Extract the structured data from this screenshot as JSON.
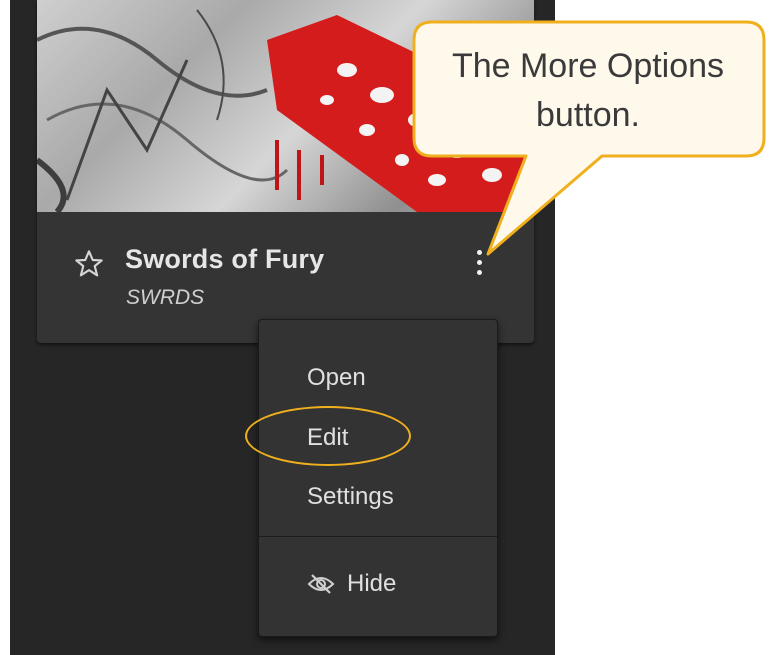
{
  "card": {
    "title": "Swords of Fury",
    "subtitle": "SWRDS",
    "favorite_icon": "star-outline-icon",
    "more_options_icon": "vertical-ellipsis-icon"
  },
  "menu": {
    "open_label": "Open",
    "edit_label": "Edit",
    "settings_label": "Settings",
    "hide_label": "Hide",
    "hide_icon": "eye-slash-icon"
  },
  "callout": {
    "text": "The More Options button."
  },
  "colors": {
    "panel_background": "#262626",
    "card_background": "#343434",
    "menu_background": "#333333",
    "highlight": "#f0b01e",
    "callout_fill": "#fff9ec"
  }
}
